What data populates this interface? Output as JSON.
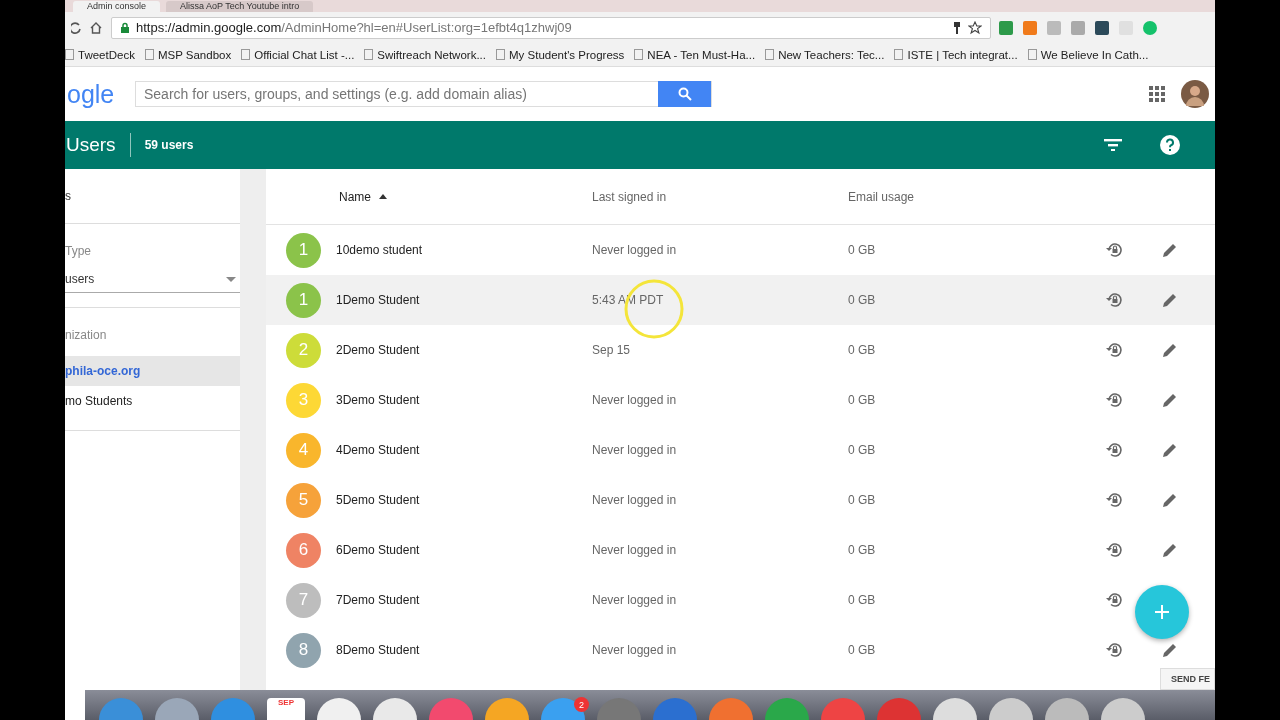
{
  "browser": {
    "tabs": [
      {
        "title": "Admin console",
        "selected": true
      },
      {
        "title": "Alissa AoP Tech Youtube intro",
        "selected": false
      }
    ],
    "url": {
      "host": "https://admin.google.com",
      "path": "/AdminHome?hl=en#UserList:org=1efbt4q1zhwj09"
    },
    "bookmarks": [
      "TweetDeck",
      "MSP Sandbox",
      "Official Chat List -...",
      "Swiftreach Network...",
      "My Student's Progress",
      "NEA - Ten Must-Ha...",
      "New Teachers: Tec...",
      "ISTE | Tech integrat...",
      "We Believe In Cath..."
    ]
  },
  "header": {
    "logo": "ogle",
    "search": {
      "placeholder": "Search for users, groups, and settings (e.g. add domain alias)"
    }
  },
  "title_bar": {
    "title": "Users",
    "count": "59 users"
  },
  "sidebar": {
    "heading": "s",
    "filter_label": "Type",
    "filter_value": "users",
    "org_label": "nization",
    "orgs": [
      {
        "name": "phila-oce.org",
        "selected": true
      },
      {
        "name": "mo Students",
        "selected": false
      }
    ]
  },
  "table": {
    "columns": [
      {
        "label": "Name",
        "sorted": true
      },
      {
        "label": "Last signed in",
        "sorted": false
      },
      {
        "label": "Email usage",
        "sorted": false
      }
    ],
    "rows": [
      {
        "initial": "1",
        "color": "#8bc34a",
        "name": "10demo student",
        "last_signed_in": "Never logged in",
        "email_usage": "0 GB",
        "highlighted": false
      },
      {
        "initial": "1",
        "color": "#8bc34a",
        "name": "1Demo Student",
        "last_signed_in": "5:43 AM PDT",
        "email_usage": "0 GB",
        "highlighted": true
      },
      {
        "initial": "2",
        "color": "#cddc39",
        "name": "2Demo Student",
        "last_signed_in": "Sep 15",
        "email_usage": "0 GB",
        "highlighted": false
      },
      {
        "initial": "3",
        "color": "#fdd835",
        "name": "3Demo Student",
        "last_signed_in": "Never logged in",
        "email_usage": "0 GB",
        "highlighted": false
      },
      {
        "initial": "4",
        "color": "#f9b62c",
        "name": "4Demo Student",
        "last_signed_in": "Never logged in",
        "email_usage": "0 GB",
        "highlighted": false
      },
      {
        "initial": "5",
        "color": "#f6a23a",
        "name": "5Demo Student",
        "last_signed_in": "Never logged in",
        "email_usage": "0 GB",
        "highlighted": false
      },
      {
        "initial": "6",
        "color": "#ef8364",
        "name": "6Demo Student",
        "last_signed_in": "Never logged in",
        "email_usage": "0 GB",
        "highlighted": false
      },
      {
        "initial": "7",
        "color": "#bdbdbd",
        "name": "7Demo Student",
        "last_signed_in": "Never logged in",
        "email_usage": "0 GB",
        "highlighted": false
      },
      {
        "initial": "8",
        "color": "#90a4ae",
        "name": "8Demo Student",
        "last_signed_in": "Never logged in",
        "email_usage": "0 GB",
        "highlighted": false
      }
    ]
  },
  "feedback": "SEND FE",
  "dock": {
    "calendar_month": "SEP",
    "badge": "2"
  }
}
